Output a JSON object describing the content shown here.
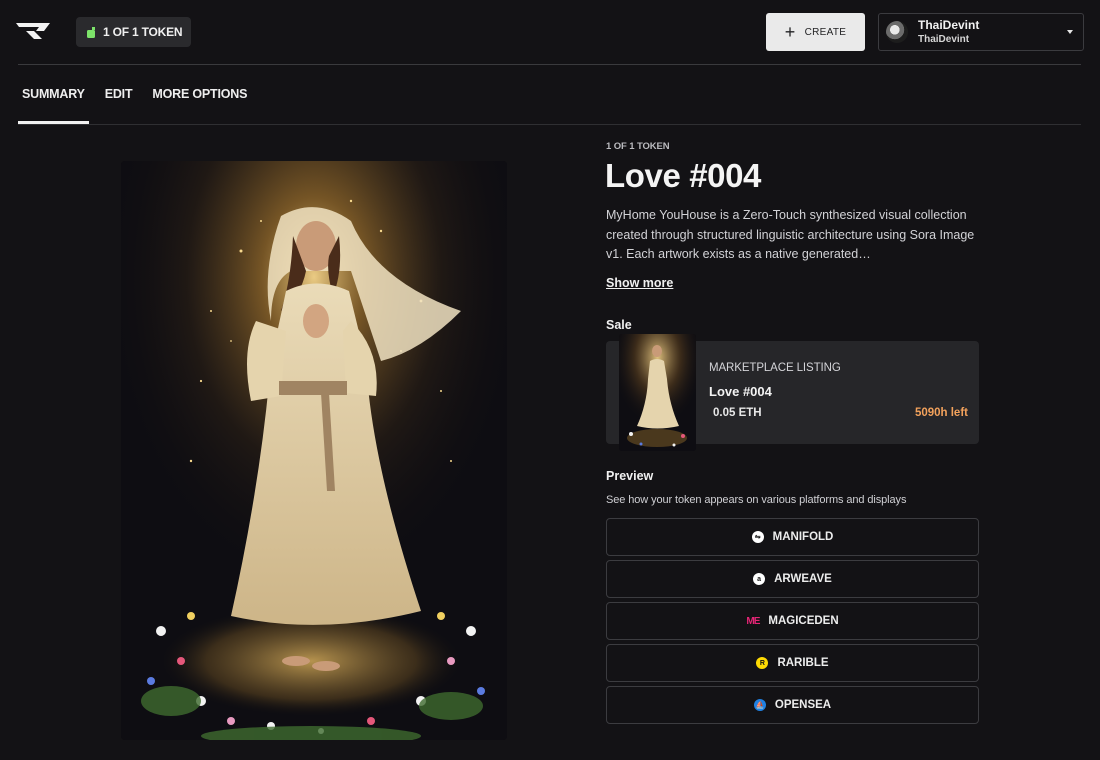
{
  "header": {
    "token_pill": "1 OF 1 TOKEN",
    "create_label": "CREATE",
    "user": {
      "name": "ThaiDevint",
      "handle": "ThaiDevint"
    }
  },
  "tabs": [
    "SUMMARY",
    "EDIT",
    "MORE OPTIONS"
  ],
  "token": {
    "eyebrow": "1 OF 1 TOKEN",
    "title": "Love #004",
    "description": "MyHome YouHouse is a Zero-Touch synthesized visual collection created through structured linguistic architecture using Sora Image v1. Each artwork exists as a native generated…",
    "show_more": "Show more"
  },
  "sale": {
    "section_label": "Sale",
    "listing_label": "MARKETPLACE LISTING",
    "listing_title": "Love #004",
    "price": "0.05 ETH",
    "time_left": "5090h left"
  },
  "preview": {
    "section_label": "Preview",
    "subtitle": "See how your token appears on various platforms and displays",
    "platforms": [
      {
        "label": "MANIFOLD",
        "icon": "manifold-icon",
        "color": "#ffffff"
      },
      {
        "label": "ARWEAVE",
        "icon": "arweave-icon",
        "color": "#ffffff"
      },
      {
        "label": "MAGICEDEN",
        "icon": "magiceden-icon",
        "color": "#e42575"
      },
      {
        "label": "RARIBLE",
        "icon": "rarible-icon",
        "color": "#feda03"
      },
      {
        "label": "OPENSEA",
        "icon": "opensea-icon",
        "color": "#2081e2"
      }
    ]
  },
  "colors": {
    "background": "#131215",
    "accent_time": "#f3a25c",
    "card": "#262629"
  }
}
